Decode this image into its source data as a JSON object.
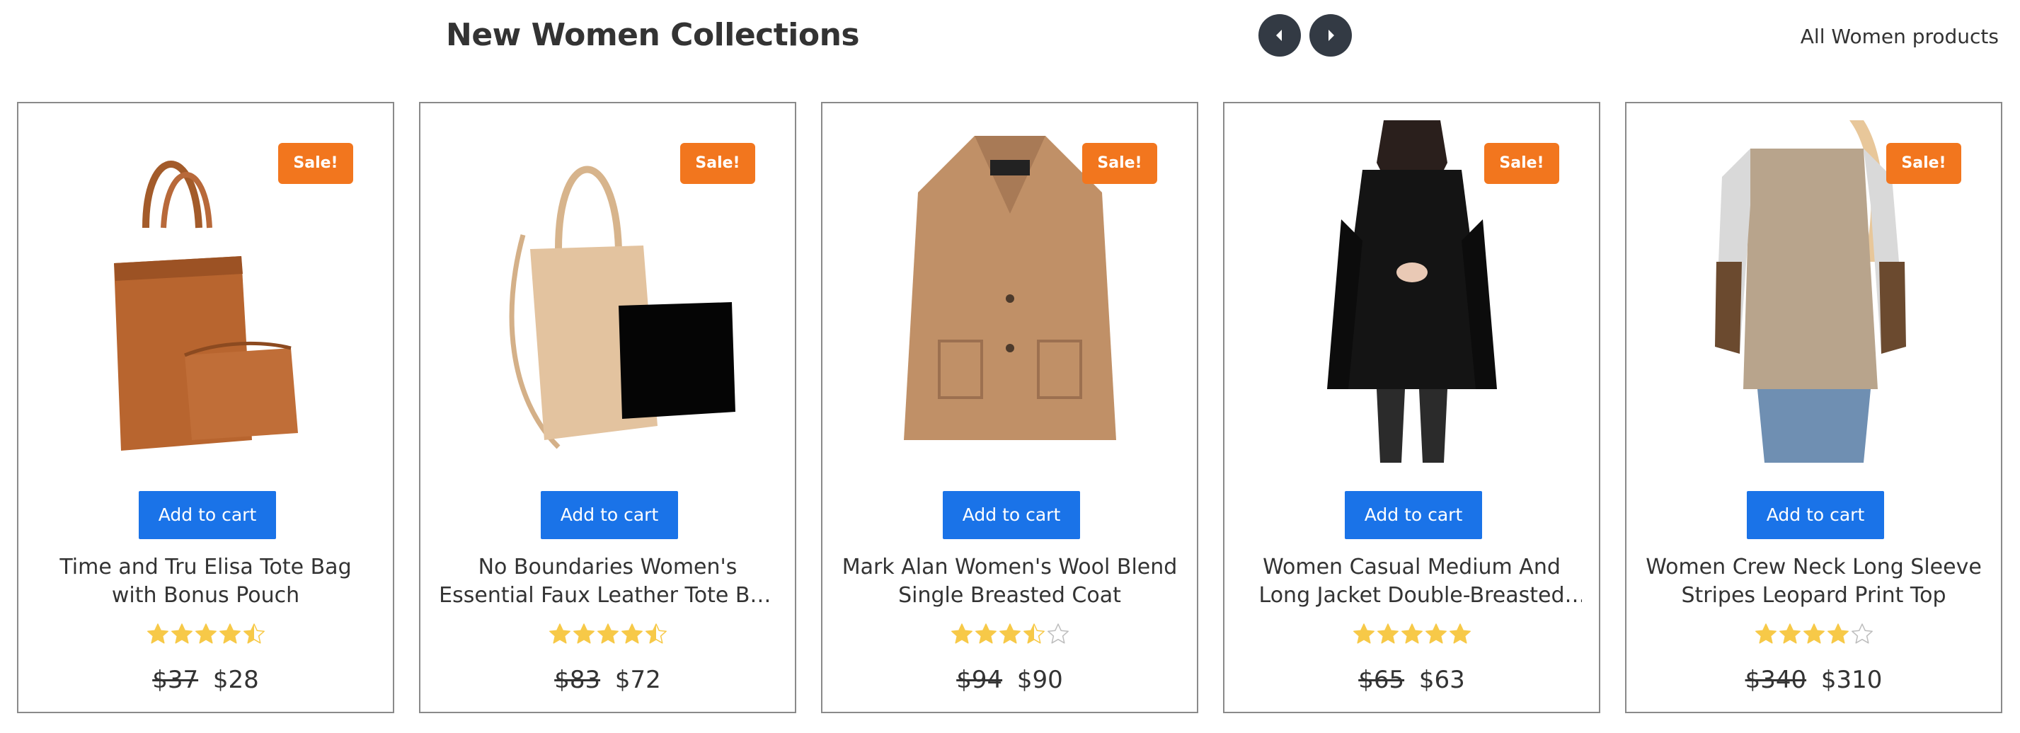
{
  "header": {
    "title": "New Women Collections",
    "all_link": "All Women products"
  },
  "icons": {
    "prev": "chevron-left-icon",
    "next": "chevron-right-icon",
    "star_full": "star-full-icon",
    "star_half": "star-half-icon",
    "star_empty": "star-empty-icon"
  },
  "colors": {
    "sale_badge": "#f2761e",
    "add_to_cart": "#1a73e8",
    "star": "#f7c948",
    "carousel_button": "#333a44"
  },
  "products": [
    {
      "name": "Time and Tru Elisa Tote Bag with Bonus Pouch",
      "badge": "Sale!",
      "cta": "Add to cart",
      "rating": 4.5,
      "old_price": "$37",
      "price": "$28",
      "image": "tote-bag-brown"
    },
    {
      "name": "No Boundaries Women's Essential Faux Leather Tote Bag with...",
      "badge": "Sale!",
      "cta": "Add to cart",
      "rating": 4.5,
      "old_price": "$83",
      "price": "$72",
      "image": "tote-bag-beige"
    },
    {
      "name": "Mark Alan Women's Wool Blend Single Breasted Coat",
      "badge": "Sale!",
      "cta": "Add to cart",
      "rating": 3.5,
      "old_price": "$94",
      "price": "$90",
      "image": "wool-coat-camel"
    },
    {
      "name": "Women Casual Medium And Long Jacket Double-Breasted Hooded...",
      "badge": "Sale!",
      "cta": "Add to cart",
      "rating": 5,
      "old_price": "$65",
      "price": "$63",
      "image": "black-jacket"
    },
    {
      "name": "Women Crew Neck Long Sleeve Stripes Leopard Print Top",
      "badge": "Sale!",
      "cta": "Add to cart",
      "rating": 4,
      "old_price": "$340",
      "price": "$310",
      "image": "leopard-top"
    }
  ]
}
